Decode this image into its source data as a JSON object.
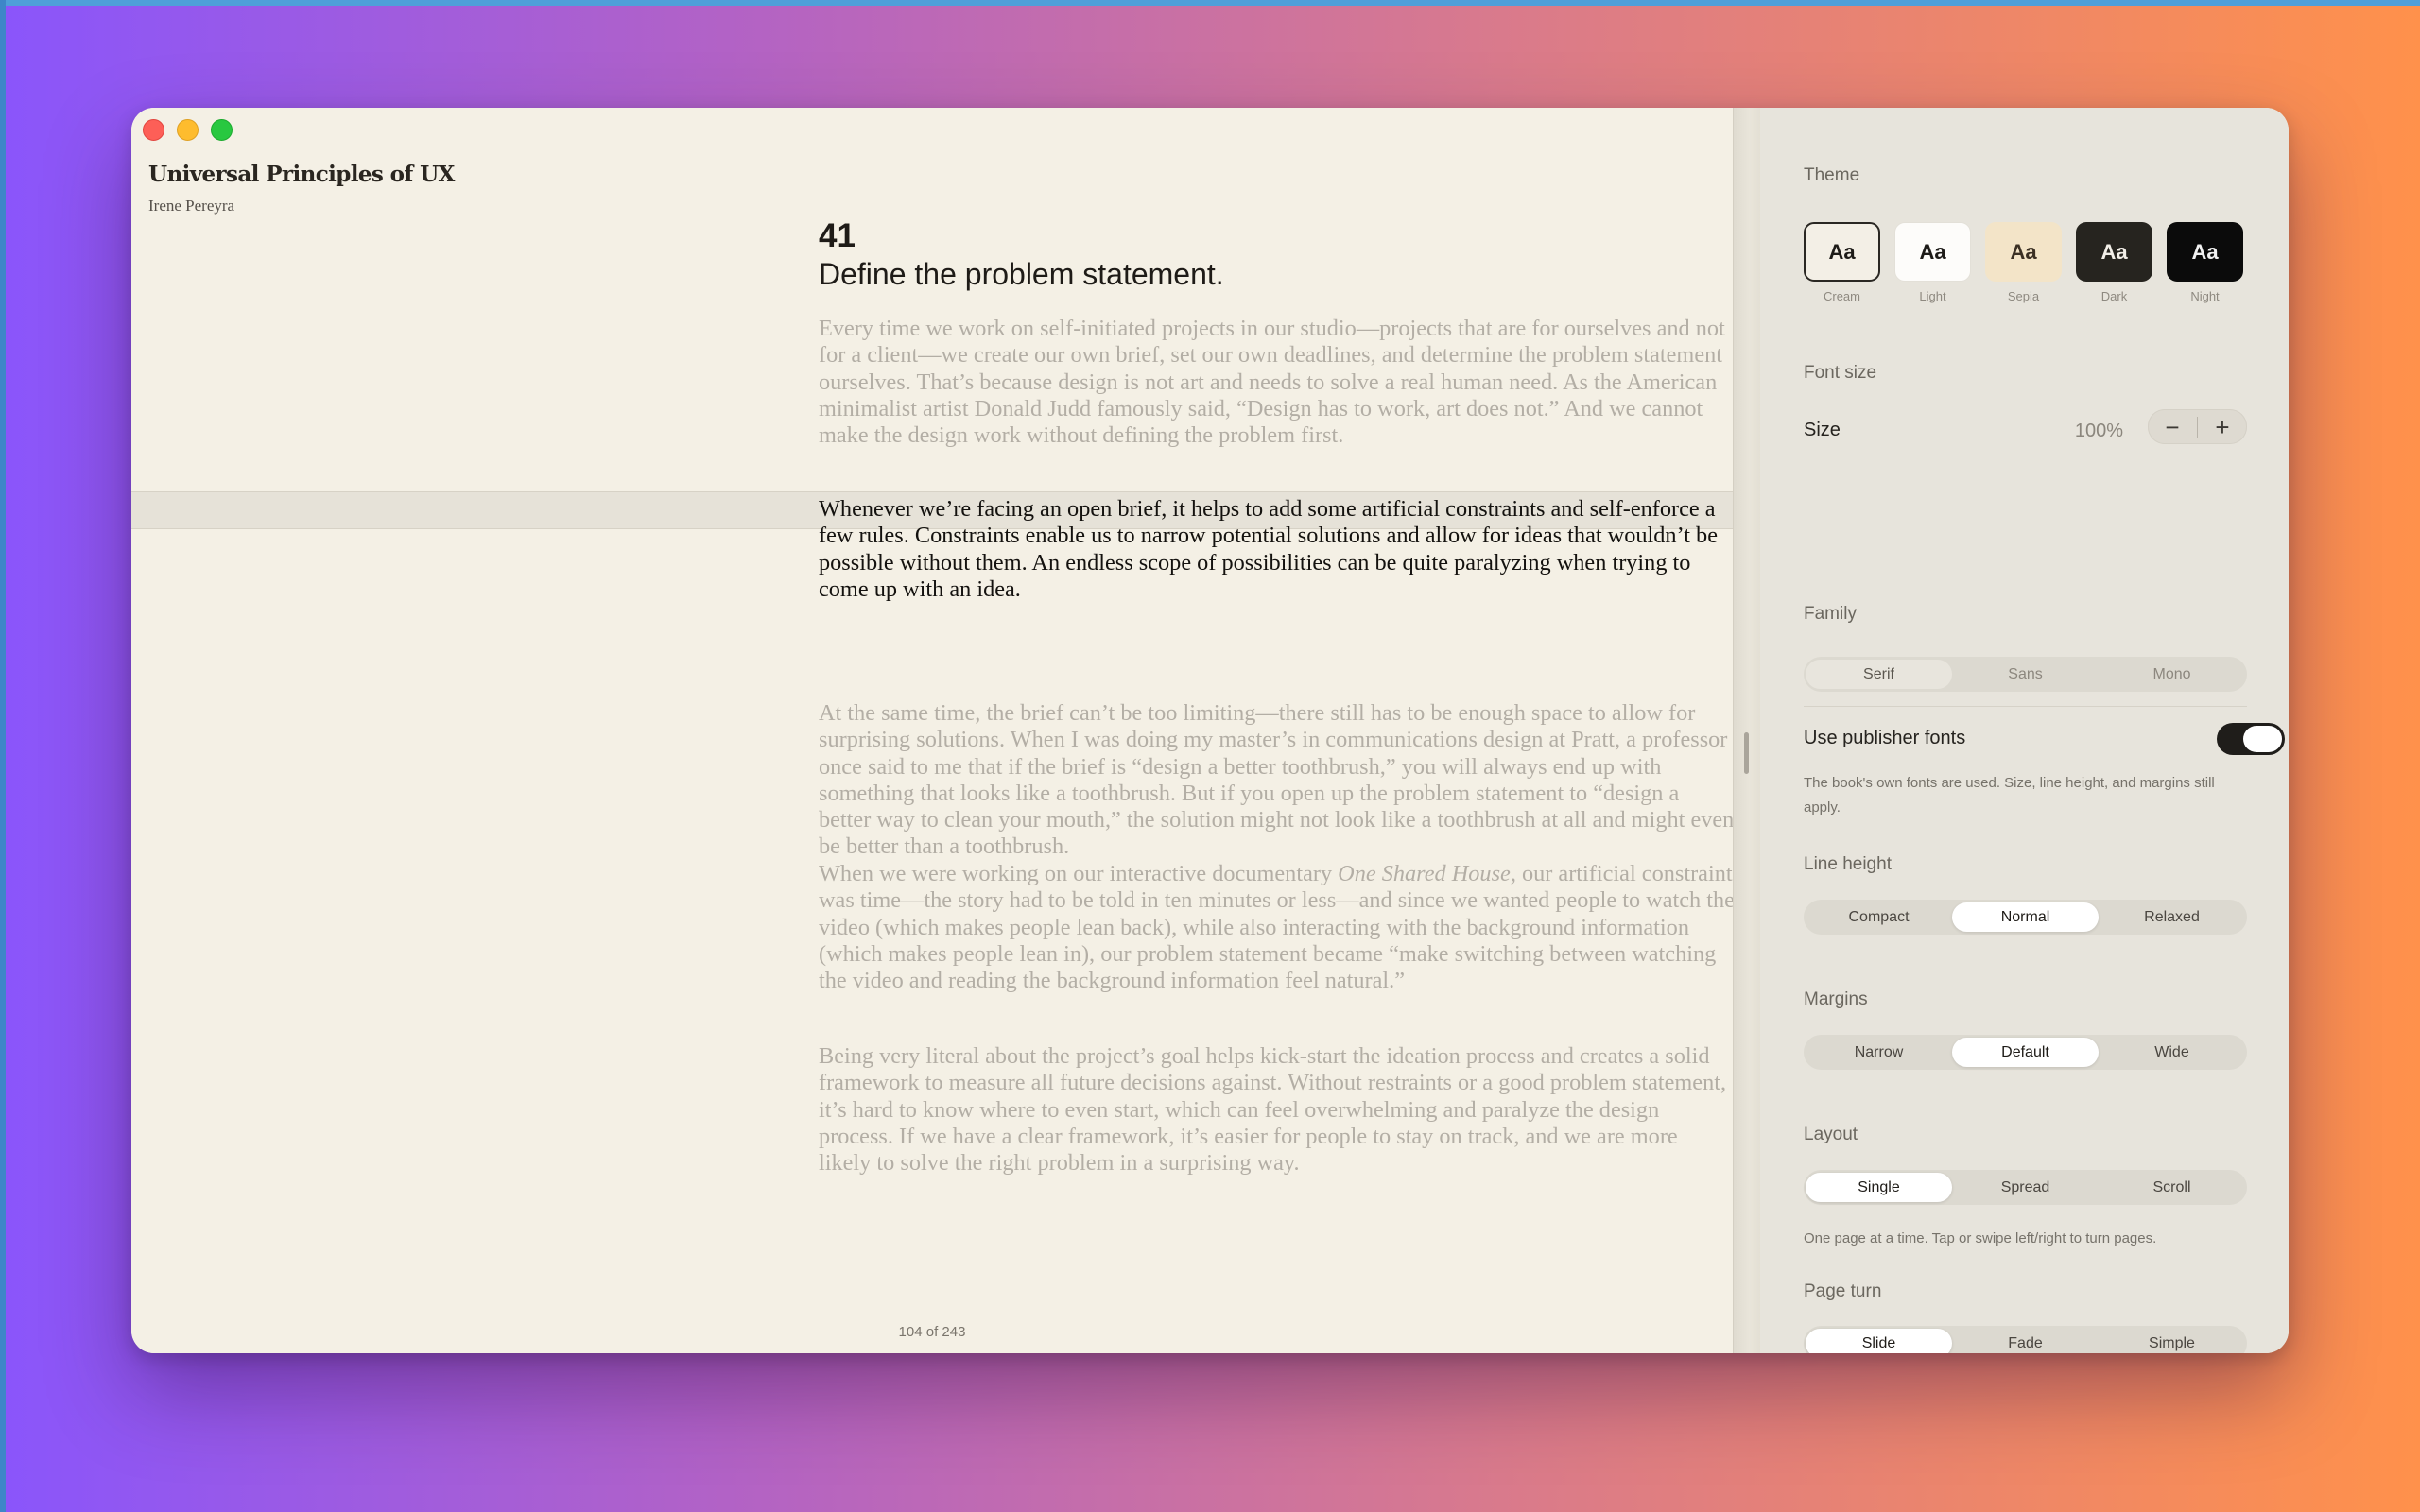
{
  "book": {
    "title": "Universal Principles of UX",
    "author": "Irene Pereyra"
  },
  "chapter": {
    "number": "41",
    "title": "Define the problem statement."
  },
  "paragraphs": [
    "Every time we work on self-initiated projects in our studio—projects that are for ourselves and not for a client—we create our own brief, set our own deadlines, and determine the problem statement ourselves. That’s because design is not art and needs to solve a real human need. As the American minimalist artist Donald Judd famously said, “Design has to work, art does not.” And we cannot make the design work without defining the problem first.",
    "Whenever we’re facing an open brief, it helps to add some artificial constraints and self-enforce a few rules. Constraints enable us to narrow potential solutions and allow for ideas that wouldn’t be possible without them. An endless scope of possibilities can be quite paralyzing when trying to come up with an idea.",
    "At the same time, the brief can’t be too limiting—there still has to be enough space to allow for surprising solutions. When I was doing my master’s in communications design at Pratt, a professor once said to me that if the brief is “design a better toothbrush,” you will always end up with something that looks like a toothbrush. But if you open up the problem statement to “design a better way to clean your mouth,” the solution might not look like a toothbrush at all and might even be better than a toothbrush.",
    "When we were working on our interactive documentary ",
    "One Shared House,",
    " our artificial constraint was time—the story had to be told in ten minutes or less—and since we wanted people to watch the video (which makes people lean back), while also interacting with the background information (which makes people lean in), our problem statement became “make switching between watching the video and reading the background information feel natural.”",
    "Being very literal about the project’s goal helps kick-start the ideation process and creates a solid framework to measure all future decisions against. Without restraints or a good problem statement, it’s hard to know where to even start, which can feel overwhelming and paralyze the design process. If we have a clear framework, it’s easier for people to stay on track, and we are more likely to solve the right problem in a surprising way."
  ],
  "page_indicator": "104 of 243",
  "settings": {
    "theme_label": "Theme",
    "themes": [
      {
        "swatch": "Aa",
        "name": "Cream",
        "selected": true
      },
      {
        "swatch": "Aa",
        "name": "Light"
      },
      {
        "swatch": "Aa",
        "name": "Sepia"
      },
      {
        "swatch": "Aa",
        "name": "Dark"
      },
      {
        "swatch": "Aa",
        "name": "Night"
      }
    ],
    "font_size_label": "Font size",
    "size_label": "Size",
    "size_value": "100%",
    "minus": "−",
    "plus": "+",
    "family_label": "Family",
    "family_options": [
      "Serif",
      "Sans",
      "Mono"
    ],
    "family_selected": "Serif",
    "publisher_fonts_label": "Use publisher fonts",
    "publisher_fonts_on": true,
    "publisher_fonts_note": "The book's own fonts are used. Size, line height, and margins still apply.",
    "line_height_label": "Line height",
    "line_height_options": [
      "Compact",
      "Normal",
      "Relaxed"
    ],
    "line_height_selected": "Normal",
    "margins_label": "Margins",
    "margins_options": [
      "Narrow",
      "Default",
      "Wide"
    ],
    "margins_selected": "Default",
    "layout_label": "Layout",
    "layout_options": [
      "Single",
      "Spread",
      "Scroll"
    ],
    "layout_selected": "Single",
    "layout_note": "One page at a time. Tap or swipe left/right to turn pages.",
    "page_turn_label": "Page turn",
    "page_turn_options": [
      "Slide",
      "Fade",
      "Simple"
    ],
    "page_turn_selected": "Slide"
  },
  "colors": {
    "background_gradient": [
      "#8a55fb",
      "#d97a8c",
      "#ff914b"
    ],
    "page": "#f4f0e5",
    "panel": "#e7e4dc"
  }
}
